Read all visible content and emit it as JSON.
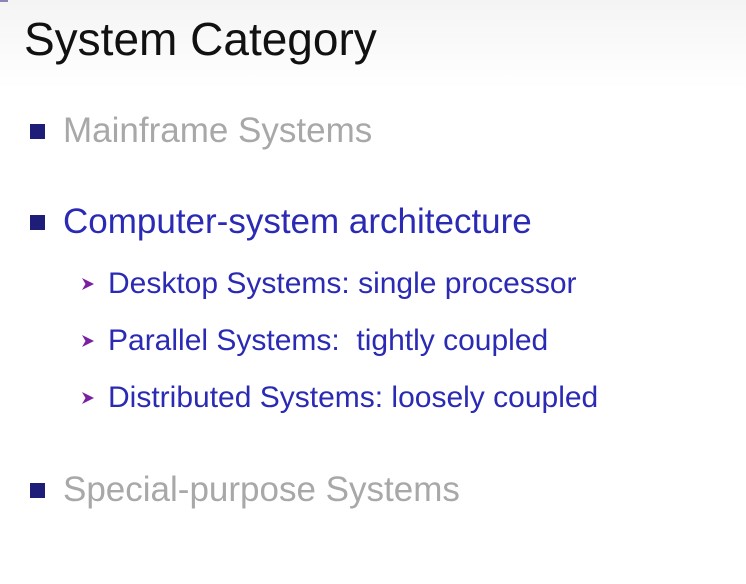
{
  "slide": {
    "title": "System Category",
    "bullets": [
      {
        "label": "Mainframe Systems",
        "state": "muted"
      },
      {
        "label": "Computer-system architecture",
        "state": "active",
        "subitems": [
          "Desktop Systems: single processor",
          "Parallel Systems:  tightly coupled",
          "Distributed Systems: loosely coupled"
        ]
      },
      {
        "label": "Special-purpose Systems",
        "state": "muted"
      }
    ]
  },
  "colors": {
    "bullet_square": "#1e1e78",
    "active_text": "#2a2ab4",
    "muted_text": "#a8a8a8",
    "sub_arrow": "#7a1fa0",
    "title_text": "#111111"
  },
  "icons": {
    "bullet": "square-bullet-icon",
    "sub_bullet": "arrowhead-bullet-icon"
  }
}
